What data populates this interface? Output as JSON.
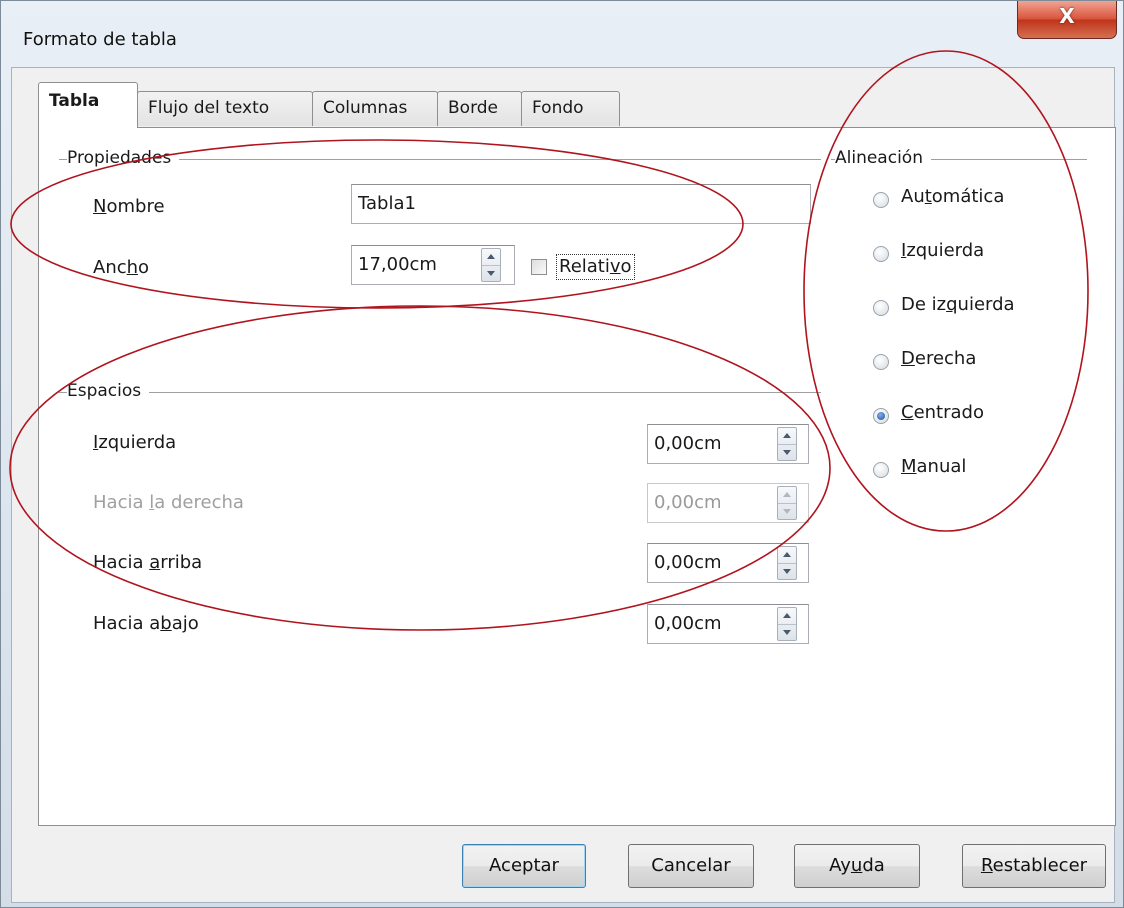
{
  "window": {
    "title": "Formato de tabla",
    "close_glyph": "X"
  },
  "tabs": [
    {
      "label": "Tabla",
      "active": true
    },
    {
      "label": "Flujo del texto",
      "active": false
    },
    {
      "label": "Columnas",
      "active": false
    },
    {
      "label": "Borde",
      "active": false
    },
    {
      "label": "Fondo",
      "active": false
    }
  ],
  "propiedades": {
    "heading": "Propiedades",
    "nombre": {
      "label_pre": "",
      "label_key": "N",
      "label_post": "ombre",
      "value": "Tabla1"
    },
    "ancho": {
      "label_pre": "Anc",
      "label_key": "h",
      "label_post": "o",
      "value": "17,00cm"
    },
    "relativo": {
      "label_pre": "Relati",
      "label_key": "v",
      "label_post": "o",
      "checked": false
    }
  },
  "espacios": {
    "heading": "Espacios",
    "izquierda": {
      "label_pre": "",
      "label_key": "I",
      "label_post": "zquierda",
      "value": "0,00cm",
      "enabled": true
    },
    "derecha": {
      "label_pre": "Hacia ",
      "label_key": "l",
      "label_post": "a derecha",
      "value": "0,00cm",
      "enabled": false
    },
    "arriba": {
      "label_pre": "Hacia ",
      "label_key": "a",
      "label_post": "rriba",
      "value": "0,00cm",
      "enabled": true
    },
    "abajo": {
      "label_pre": "Hacia a",
      "label_key": "b",
      "label_post": "ajo",
      "value": "0,00cm",
      "enabled": true
    }
  },
  "alineacion": {
    "heading": "Alineación",
    "options": [
      {
        "label_pre": "Au",
        "label_key": "t",
        "label_post": "omática",
        "checked": false
      },
      {
        "label_pre": "",
        "label_key": "I",
        "label_post": "zquierda",
        "checked": false
      },
      {
        "label_pre": "De iz",
        "label_key": "q",
        "label_post": "uierda",
        "checked": false
      },
      {
        "label_pre": "",
        "label_key": "D",
        "label_post": "erecha",
        "checked": false
      },
      {
        "label_pre": "",
        "label_key": "C",
        "label_post": "entrado",
        "checked": true
      },
      {
        "label_pre": "",
        "label_key": "M",
        "label_post": "anual",
        "checked": false
      }
    ]
  },
  "buttons": {
    "aceptar": {
      "label_pre": "Aceptar",
      "label_key": "",
      "label_post": ""
    },
    "cancelar": {
      "label_pre": "Cancelar",
      "label_key": "",
      "label_post": ""
    },
    "ayuda": {
      "label_pre": "Ay",
      "label_key": "u",
      "label_post": "da"
    },
    "restablecer": {
      "label_pre": "",
      "label_key": "R",
      "label_post": "establecer"
    }
  },
  "colors": {
    "annotation": "#b0141e",
    "radio_selected": "#1e4f9a"
  }
}
